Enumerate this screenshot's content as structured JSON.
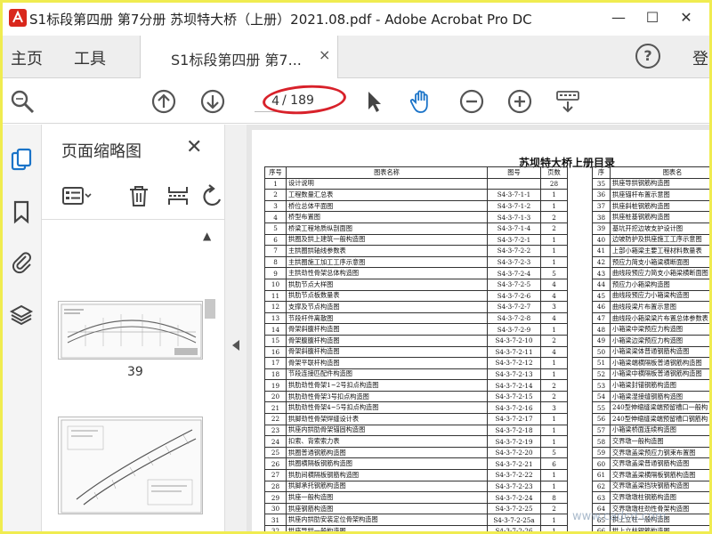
{
  "window": {
    "title": "S1标段第四册  第7分册 苏坝特大桥（上册）2021.08.pdf - Adobe Acrobat Pro DC",
    "minimize": "—",
    "maximize": "☐",
    "close": "✕"
  },
  "menu": {
    "home": "主页",
    "tools": "工具",
    "signin": "登"
  },
  "tab": {
    "label": "S1标段第四册  第7...",
    "close": "×"
  },
  "help": {
    "label": "?"
  },
  "toolbar": {
    "page_current": "4",
    "page_total": "/ 189"
  },
  "thumbnails": {
    "title": "页面缩略图",
    "close": "✕",
    "page_label": "39"
  },
  "document": {
    "heading": "苏坝特大桥上册目录",
    "left_headers": [
      "序号",
      "图表名称",
      "图号",
      "页数"
    ],
    "left_rows": [
      [
        "1",
        "设计说明",
        "",
        "28"
      ],
      [
        "2",
        "工程数量汇总表",
        "S4-3-7-1-1",
        "1"
      ],
      [
        "3",
        "桥位总体平面图",
        "S4-3-7-1-2",
        "1"
      ],
      [
        "4",
        "桥型布置图",
        "S4-3-7-1-3",
        "2"
      ],
      [
        "5",
        "桥梁工程地质纵剖面图",
        "S4-3-7-1-4",
        "2"
      ],
      [
        "6",
        "拱圈及拱上建筑一般构造图",
        "S4-3-7-2-1",
        "1"
      ],
      [
        "7",
        "主拱圈拱轴线参数表",
        "S4-3-7-2-2",
        "1"
      ],
      [
        "8",
        "主拱圈施工加工工序示意图",
        "S4-3-7-2-3",
        "1"
      ],
      [
        "9",
        "主拱劲性骨架总体构造图",
        "S4-3-7-2-4",
        "5"
      ],
      [
        "10",
        "拱肋节点大样图",
        "S4-3-7-2-5",
        "4"
      ],
      [
        "11",
        "拱肋节点板数量表",
        "S4-3-7-2-6",
        "4"
      ],
      [
        "12",
        "支撑及节点构造图",
        "S4-3-7-2-7",
        "3"
      ],
      [
        "13",
        "节段杆件离散图",
        "S4-3-7-2-8",
        "4"
      ],
      [
        "14",
        "骨架斜腹杆构造图",
        "S4-3-7-2-9",
        "1"
      ],
      [
        "15",
        "骨架腹腹杆构造图",
        "S4-3-7-2-10",
        "2"
      ],
      [
        "16",
        "骨架斜腹杆构造图",
        "S4-3-7-2-11",
        "4"
      ],
      [
        "17",
        "骨架平联杆构造图",
        "S4-3-7-2-12",
        "1"
      ],
      [
        "18",
        "节段连接匹配件构造图",
        "S4-3-7-2-13",
        "1"
      ],
      [
        "19",
        "拱肋劲性骨架1~2号扣点构造图",
        "S4-3-7-2-14",
        "2"
      ],
      [
        "20",
        "拱肋劲性骨架3号扣点构造图",
        "S4-3-7-2-15",
        "2"
      ],
      [
        "21",
        "拱肋劲性骨架4~5号扣点构造图",
        "S4-3-7-2-16",
        "3"
      ],
      [
        "22",
        "拱脚劲性骨架焊缝设计表",
        "S4-3-7-2-17",
        "1"
      ],
      [
        "23",
        "拱座内拱肋骨架锚固构造图",
        "S4-3-7-2-18",
        "1"
      ],
      [
        "24",
        "扣索、背索索力表",
        "S4-3-7-2-19",
        "1"
      ],
      [
        "25",
        "拱圈普通钢筋构造图",
        "S4-3-7-2-20",
        "5"
      ],
      [
        "26",
        "拱圈横隔板钢筋构造图",
        "S4-3-7-2-21",
        "6"
      ],
      [
        "27",
        "拱肋间横隔板钢筋构造图",
        "S4-3-7-2-22",
        "1"
      ],
      [
        "28",
        "拱脚承托钢筋构造图",
        "S4-3-7-2-23",
        "1"
      ],
      [
        "29",
        "拱座一般构造图",
        "S4-3-7-2-24",
        "8"
      ],
      [
        "30",
        "拱座钢筋构造图",
        "S4-3-7-2-25",
        "2"
      ],
      [
        "31",
        "拱座内拱肋安装定位骨架构造图",
        "S4-3-7-2-25a",
        "1"
      ],
      [
        "32",
        "拱座导拱一般构造图",
        "S4-3-7-2-26",
        "1"
      ]
    ],
    "right_headers": [
      "序",
      "图表名"
    ],
    "right_rows": [
      [
        "35",
        "拱座导拱钢筋构造图"
      ],
      [
        "36",
        "拱座锚杆布置示意图"
      ],
      [
        "37",
        "拱座斜桩钢筋构造图"
      ],
      [
        "38",
        "拱座桩基钢筋构造图"
      ],
      [
        "39",
        "基坑开挖边坡支护设计图"
      ],
      [
        "40",
        "边坡防护及拱座施工工序示意图"
      ],
      [
        "41",
        "上部小箱梁主要工程材料数量表"
      ],
      [
        "42",
        "预应力简支小箱梁横断面图"
      ],
      [
        "43",
        "曲线段预应力简支小箱梁横断面图"
      ],
      [
        "44",
        "预应力小箱梁构造图"
      ],
      [
        "45",
        "曲线段预应力小箱梁构造图"
      ],
      [
        "46",
        "曲线段梁片布置示意图"
      ],
      [
        "47",
        "曲线段小箱梁梁片布置总体参数表"
      ],
      [
        "48",
        "小箱梁中梁预应力构造图"
      ],
      [
        "49",
        "小箱梁边梁预应力构造图"
      ],
      [
        "50",
        "小箱梁梁体普通钢筋构造图"
      ],
      [
        "51",
        "小箱梁端横隔板普通钢筋构造图"
      ],
      [
        "52",
        "小箱梁中横隔板普通钢筋构造图"
      ],
      [
        "53",
        "小箱梁封锚钢筋构造图"
      ],
      [
        "54",
        "小箱梁湿接缝钢筋构造图"
      ],
      [
        "55",
        "240型伸缩缝梁端预留槽口一般构"
      ],
      [
        "56",
        "240型伸缩缝梁端预留槽口钢筋构"
      ],
      [
        "57",
        "小箱梁桥面连续构造图"
      ],
      [
        "58",
        "交界墩一般构造图"
      ],
      [
        "59",
        "交界墩盖梁预应力钢束布置图"
      ],
      [
        "60",
        "交界墩盖梁普通钢筋构造图"
      ],
      [
        "61",
        "交界墩盖梁横隔板钢筋构造图"
      ],
      [
        "62",
        "交界墩盖梁挡块钢筋构造图"
      ],
      [
        "63",
        "交界墩墩柱钢筋构造图"
      ],
      [
        "64",
        "交界墩墩柱劲性骨架构造图"
      ],
      [
        "65",
        "拱上立柱一般构造图"
      ],
      [
        "66",
        "拱上立柱钢筋构造图"
      ]
    ]
  },
  "watermark": "www.cadcd.com"
}
